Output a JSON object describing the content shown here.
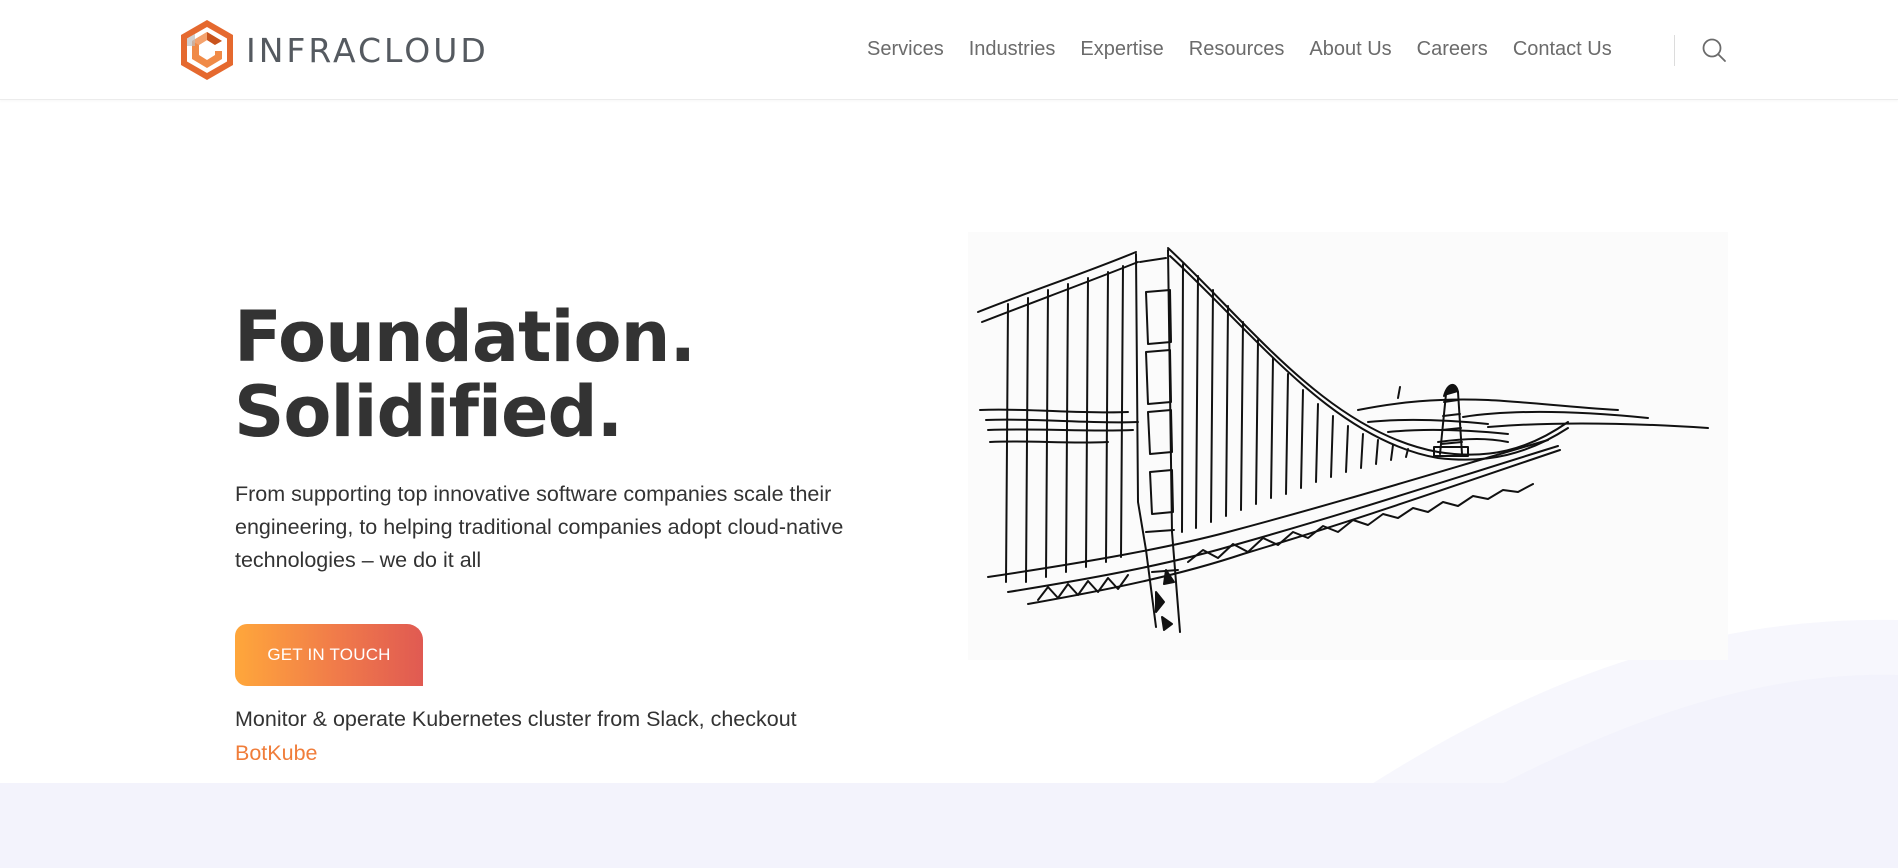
{
  "brand": {
    "name": "INFRACLOUD",
    "colors": {
      "orange": "#f07d3a",
      "gradient_start": "#ffa73b",
      "gradient_end": "#e05a52",
      "text": "#333333",
      "nav_text": "#6b6b6b",
      "band": "#f3f3fc"
    }
  },
  "nav": {
    "items": [
      {
        "label": "Services"
      },
      {
        "label": "Industries"
      },
      {
        "label": "Expertise"
      },
      {
        "label": "Resources"
      },
      {
        "label": "About Us"
      },
      {
        "label": "Careers"
      },
      {
        "label": "Contact Us"
      }
    ],
    "search_icon": "search-icon"
  },
  "hero": {
    "title_line1": "Foundation.",
    "title_line2": "Solidified.",
    "description": "From supporting top innovative software companies scale their engineering, to helping traditional companies adopt cloud-native technologies – we do it all",
    "cta_label": "GET IN TOUCH",
    "promo_text": "Monitor & operate Kubernetes cluster from Slack, checkout",
    "promo_link": "BotKube",
    "illustration": "golden-gate-bridge-sketch"
  }
}
